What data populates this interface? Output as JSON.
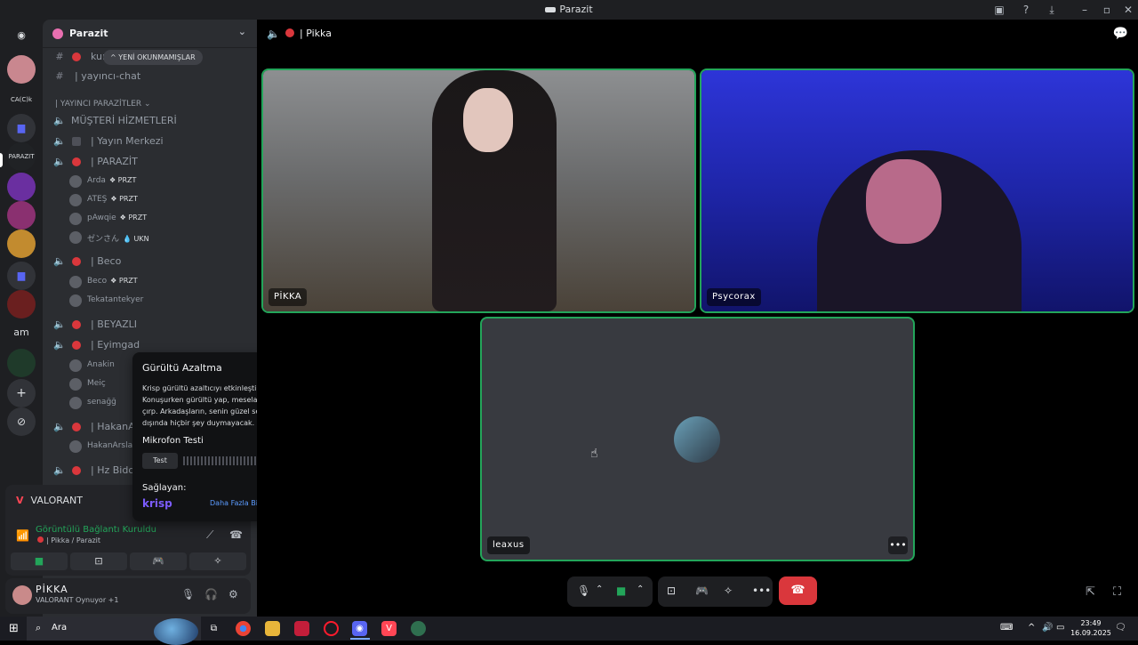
{
  "window": {
    "title": "Parazit"
  },
  "server": {
    "name": "Parazit"
  },
  "unread_pill": "YENİ OKUNMAMIŞLAR",
  "channels": [
    {
      "type": "text",
      "name": "kurallar",
      "dot": false
    },
    {
      "type": "text",
      "name": "| yayıncı-chat",
      "dot": false
    }
  ],
  "category": "| YAYINCI PARAZİTLER",
  "voice": {
    "musteri": "MÜŞTERİ HİZMETLERİ",
    "yayin": "| Yayın Merkezi",
    "parazit": "| PARAZİT",
    "parazit_users": [
      {
        "name": "Arda",
        "tag": "PRZT"
      },
      {
        "name": "ATEŞ",
        "tag": "PRZT"
      },
      {
        "name": "pAwqie",
        "tag": "PRZT"
      },
      {
        "name": "ゼンさん",
        "tag": "UKN"
      }
    ],
    "beco": "| Beco",
    "beco_users": [
      {
        "name": "Beco",
        "tag": "PRZT"
      },
      {
        "name": "Tekatantekyer",
        "tag": ""
      }
    ],
    "beyazli": "| BEYAZLI",
    "eyimgad": "| Eyimgad",
    "eyimgad_users": [
      {
        "name": "Anakin",
        "tag": ""
      },
      {
        "name": "Meiç",
        "tag": ""
      },
      {
        "name": "senağğ",
        "tag": ""
      }
    ],
    "hakan": "| HakanArsl",
    "hakan_users": [
      {
        "name": "HakanArslan",
        "tag": ""
      }
    ],
    "hz": "| Hz Bidonc"
  },
  "activity": {
    "game": "VALORANT",
    "status": "Görüntülü Bağlantı Kuruldu",
    "sub": "| Pikka / Parazit"
  },
  "user": {
    "name": "PİKKA",
    "status": "VALORANT Oynuyor +1"
  },
  "krisp": {
    "title": "Gürültü Azaltma",
    "desc": "Krisp gürültü azaltıcıyı etkinleştir! Konuşurken gürültü yap, mesela ellerini çırp. Arkadaşların, senin güzel sesin dışında hiçbir şey duymayacak.",
    "mic_test": "Mikrofon Testi",
    "test_button": "Test",
    "provider": "Sağlayan:",
    "brand": "krisp",
    "link": "Daha Fazla Bilgi Edin"
  },
  "call": {
    "channel": "| Pikka",
    "tiles": [
      "PİKKA",
      "Psycorax",
      "leaxus"
    ]
  },
  "taskbar": {
    "search": "Ara",
    "time": "23:49",
    "date": "16.09.2025"
  },
  "colors": {
    "accent": "#23a55a",
    "danger": "#da373c",
    "bg": "#1e1f22",
    "sidebar": "#2b2d31"
  }
}
